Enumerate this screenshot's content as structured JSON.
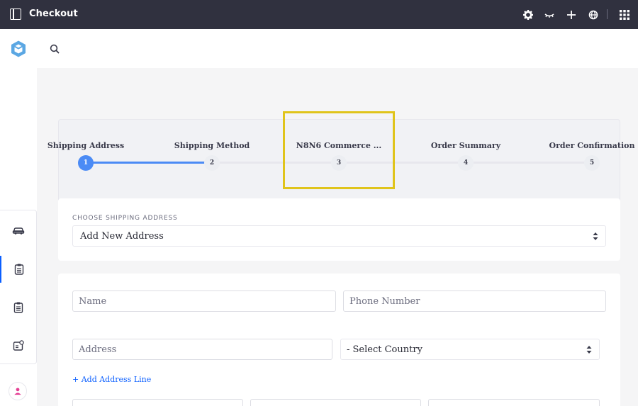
{
  "app": {
    "title": "Checkout"
  },
  "topbar_icons": [
    "gear-icon",
    "simulation-icon",
    "plus-icon",
    "globe-icon",
    "apps-grid-icon"
  ],
  "stepper": {
    "steps": [
      {
        "label": "Shipping Address",
        "number": "1",
        "state": "active"
      },
      {
        "label": "Shipping Method",
        "number": "2",
        "state": "pending"
      },
      {
        "label": "N8N6 Commerce ...",
        "number": "3",
        "state": "pending"
      },
      {
        "label": "Order Summary",
        "number": "4",
        "state": "pending"
      },
      {
        "label": "Order Confirmation",
        "number": "5",
        "state": "pending"
      }
    ]
  },
  "address_select": {
    "label": "CHOOSE SHIPPING ADDRESS",
    "value": "Add New Address"
  },
  "form": {
    "name_placeholder": "Name",
    "phone_placeholder": "Phone Number",
    "address_placeholder": "Address",
    "country_value": "- Select Country",
    "add_line_label": "+ Add Address Line"
  },
  "colors": {
    "topbar": "#30313f",
    "accent": "#4b8bf5",
    "link": "#0b5fff",
    "highlight": "#e0c41b"
  }
}
